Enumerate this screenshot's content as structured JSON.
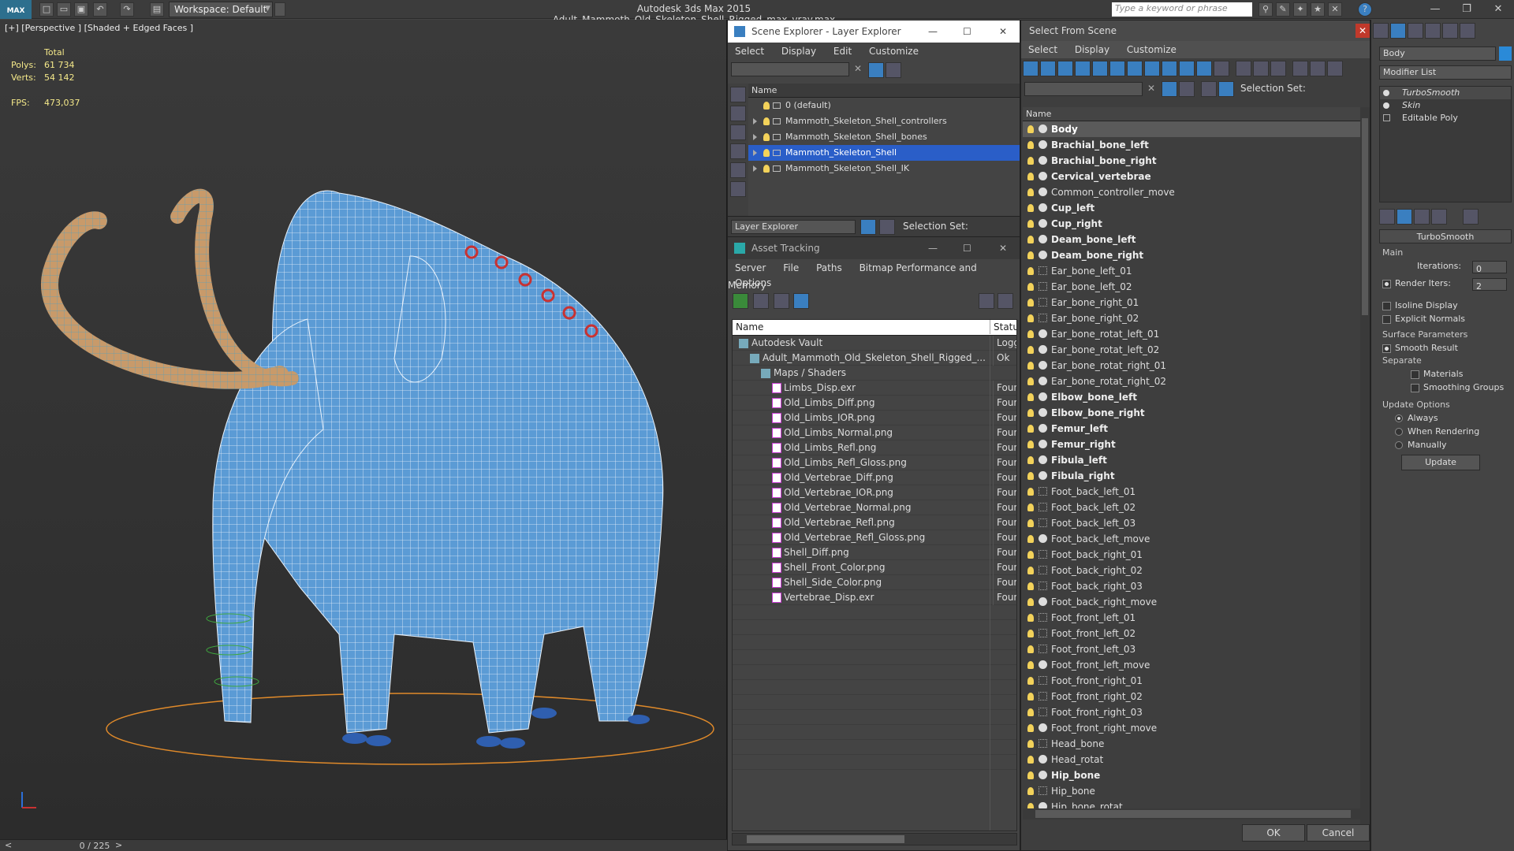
{
  "titlebar": {
    "logo": "MAX",
    "workspace": "Workspace: Default",
    "title": "Autodesk 3ds Max  2015    Adult_Mammoth_Old_Skeleton_Shell_Rigged_max_vray.max",
    "search_placeholder": "Type a keyword or phrase"
  },
  "viewport": {
    "label": "[+] [Perspective ] [Shaded + Edged Faces ]",
    "stats": {
      "total": "Total",
      "polys_label": "Polys:",
      "polys": "61 734",
      "verts_label": "Verts:",
      "verts": "54 142",
      "fps_label": "FPS:",
      "fps": "473,037"
    },
    "frame": "0 / 225"
  },
  "layer_explorer": {
    "title": "Scene Explorer - Layer Explorer",
    "menu": [
      "Select",
      "Display",
      "Edit",
      "Customize"
    ],
    "column": "Name",
    "rows": [
      {
        "name": "0 (default)",
        "expand": false
      },
      {
        "name": "Mammoth_Skeleton_Shell_controllers",
        "expand": true
      },
      {
        "name": "Mammoth_Skeleton_Shell_bones",
        "expand": true
      },
      {
        "name": "Mammoth_Skeleton_Shell",
        "expand": true,
        "selected": true
      },
      {
        "name": "Mammoth_Skeleton_Shell_IK",
        "expand": true
      }
    ],
    "footer_dropdown": "Layer Explorer",
    "selection_set": "Selection Set:"
  },
  "asset_tracking": {
    "title": "Asset Tracking",
    "menu": [
      "Server",
      "File",
      "Paths",
      "Bitmap Performance and Memory"
    ],
    "menu2": "Options",
    "col_name": "Name",
    "col_status": "Status",
    "rows": [
      {
        "name": "Autodesk Vault",
        "status": "Logged",
        "indent": 1
      },
      {
        "name": "Adult_Mammoth_Old_Skeleton_Shell_Rigged_...",
        "status": "Ok",
        "indent": 2
      },
      {
        "name": "Maps / Shaders",
        "status": "",
        "indent": 3
      },
      {
        "name": "Limbs_Disp.exr",
        "status": "Found",
        "indent": 4
      },
      {
        "name": "Old_Limbs_Diff.png",
        "status": "Found",
        "indent": 4
      },
      {
        "name": "Old_Limbs_IOR.png",
        "status": "Found",
        "indent": 4
      },
      {
        "name": "Old_Limbs_Normal.png",
        "status": "Found",
        "indent": 4
      },
      {
        "name": "Old_Limbs_Refl.png",
        "status": "Found",
        "indent": 4
      },
      {
        "name": "Old_Limbs_Refl_Gloss.png",
        "status": "Found",
        "indent": 4
      },
      {
        "name": "Old_Vertebrae_Diff.png",
        "status": "Found",
        "indent": 4
      },
      {
        "name": "Old_Vertebrae_IOR.png",
        "status": "Found",
        "indent": 4
      },
      {
        "name": "Old_Vertebrae_Normal.png",
        "status": "Found",
        "indent": 4
      },
      {
        "name": "Old_Vertebrae_Refl.png",
        "status": "Found",
        "indent": 4
      },
      {
        "name": "Old_Vertebrae_Refl_Gloss.png",
        "status": "Found",
        "indent": 4
      },
      {
        "name": "Shell_Diff.png",
        "status": "Found",
        "indent": 4
      },
      {
        "name": "Shell_Front_Color.png",
        "status": "Found",
        "indent": 4
      },
      {
        "name": "Shell_Side_Color.png",
        "status": "Found",
        "indent": 4
      },
      {
        "name": "Vertebrae_Disp.exr",
        "status": "Found",
        "indent": 4
      }
    ]
  },
  "select_from_scene": {
    "title": "Select From Scene",
    "menu": [
      "Select",
      "Display",
      "Customize"
    ],
    "selection_set": "Selection Set:",
    "column": "Name",
    "rows": [
      {
        "name": "Body",
        "bold": true,
        "sel": true
      },
      {
        "name": "Brachial_bone_left",
        "bold": true
      },
      {
        "name": "Brachial_bone_right",
        "bold": true
      },
      {
        "name": "Cervical_vertebrae",
        "bold": true
      },
      {
        "name": "Common_controller_move",
        "bold": false
      },
      {
        "name": "Cup_left",
        "bold": true
      },
      {
        "name": "Cup_right",
        "bold": true
      },
      {
        "name": "Deam_bone_left",
        "bold": true
      },
      {
        "name": "Deam_bone_right",
        "bold": true
      },
      {
        "name": "Ear_bone_left_01",
        "bold": false,
        "dot": true
      },
      {
        "name": "Ear_bone_left_02",
        "bold": false,
        "dot": true
      },
      {
        "name": "Ear_bone_right_01",
        "bold": false,
        "dot": true
      },
      {
        "name": "Ear_bone_right_02",
        "bold": false,
        "dot": true
      },
      {
        "name": "Ear_bone_rotat_left_01",
        "bold": false
      },
      {
        "name": "Ear_bone_rotat_left_02",
        "bold": false
      },
      {
        "name": "Ear_bone_rotat_right_01",
        "bold": false
      },
      {
        "name": "Ear_bone_rotat_right_02",
        "bold": false
      },
      {
        "name": "Elbow_bone_left",
        "bold": true
      },
      {
        "name": "Elbow_bone_right",
        "bold": true
      },
      {
        "name": "Femur_left",
        "bold": true
      },
      {
        "name": "Femur_right",
        "bold": true
      },
      {
        "name": "Fibula_left",
        "bold": true
      },
      {
        "name": "Fibula_right",
        "bold": true
      },
      {
        "name": "Foot_back_left_01",
        "bold": false,
        "dot": true
      },
      {
        "name": "Foot_back_left_02",
        "bold": false,
        "dot": true
      },
      {
        "name": "Foot_back_left_03",
        "bold": false,
        "dot": true
      },
      {
        "name": "Foot_back_left_move",
        "bold": false
      },
      {
        "name": "Foot_back_right_01",
        "bold": false,
        "dot": true
      },
      {
        "name": "Foot_back_right_02",
        "bold": false,
        "dot": true
      },
      {
        "name": "Foot_back_right_03",
        "bold": false,
        "dot": true
      },
      {
        "name": "Foot_back_right_move",
        "bold": false
      },
      {
        "name": "Foot_front_left_01",
        "bold": false,
        "dot": true
      },
      {
        "name": "Foot_front_left_02",
        "bold": false,
        "dot": true
      },
      {
        "name": "Foot_front_left_03",
        "bold": false,
        "dot": true
      },
      {
        "name": "Foot_front_left_move",
        "bold": false
      },
      {
        "name": "Foot_front_right_01",
        "bold": false,
        "dot": true
      },
      {
        "name": "Foot_front_right_02",
        "bold": false,
        "dot": true
      },
      {
        "name": "Foot_front_right_03",
        "bold": false,
        "dot": true
      },
      {
        "name": "Foot_front_right_move",
        "bold": false
      },
      {
        "name": "Head_bone",
        "bold": false,
        "dot": true
      },
      {
        "name": "Head_rotat",
        "bold": false
      },
      {
        "name": "Hip_bone",
        "bold": true
      },
      {
        "name": "Hip_bone",
        "bold": false,
        "dot": true
      },
      {
        "name": "Hip_bone_rotat",
        "bold": false
      }
    ],
    "ok": "OK",
    "cancel": "Cancel"
  },
  "command_panel": {
    "object_name": "Body",
    "modifier_list": "Modifier List",
    "stack": [
      "TurboSmooth",
      "Skin",
      "Editable Poly"
    ],
    "rollout": "TurboSmooth",
    "main": "Main",
    "iterations_label": "Iterations:",
    "iterations": "0",
    "render_iters_label": "Render Iters:",
    "render_iters": "2",
    "isoline": "Isoline Display",
    "explicit_normals": "Explicit Normals",
    "surface_params": "Surface Parameters",
    "smooth_result": "Smooth Result",
    "separate": "Separate",
    "materials": "Materials",
    "smoothing_groups": "Smoothing Groups",
    "update_options": "Update Options",
    "always": "Always",
    "when_rendering": "When Rendering",
    "manually": "Manually",
    "update": "Update"
  },
  "colors": {
    "selection": "#2a5ec8",
    "mesh": "#5b9bd5",
    "tusk": "#c89a6a",
    "stats": "#f5e98a"
  }
}
